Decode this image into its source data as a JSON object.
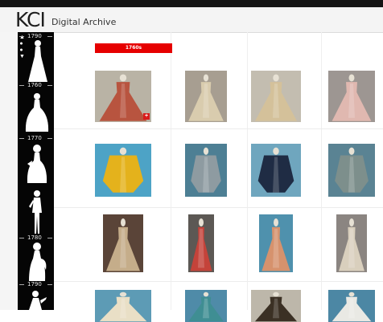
{
  "header": {
    "brand": "KCI",
    "subtitle": "Digital Archive"
  },
  "timeline": {
    "up_icon": "arrow-up-icon",
    "down_icon": "arrow-down-icon",
    "years": [
      "1790",
      "1760",
      "1770",
      "1780",
      "1790"
    ],
    "silhouettes": [
      "gown-icon",
      "gown-icon",
      "gown-icon",
      "figure-icon",
      "gown-icon",
      "figure-icon"
    ]
  },
  "grid": {
    "decade_label": "1760s",
    "rows": [
      [
        {
          "name": "robe-a-la-francaise-floral-red",
          "bg": "#b9b3a5",
          "dress": "#b8543f"
        },
        {
          "name": "robe-a-la-francaise-ivory",
          "bg": "#a79e91",
          "dress": "#d9ccae"
        },
        {
          "name": "robe-a-la-francaise-cream",
          "bg": "#c3bdb0",
          "dress": "#d4c19a"
        },
        {
          "name": "robe-a-la-francaise-pink",
          "bg": "#9d9692",
          "dress": "#e0b8b0"
        }
      ],
      [
        {
          "name": "jacket-yellow",
          "bg": "#4da3c6",
          "dress": "#e4b21c"
        },
        {
          "name": "jacket-grey-blue",
          "bg": "#4d7f94",
          "dress": "#8e9ba1"
        },
        {
          "name": "petticoat-navy",
          "bg": "#6fa6be",
          "dress": "#1f2c44"
        },
        {
          "name": "robe-grey-green",
          "bg": "#5a8393",
          "dress": "#7d8f8c"
        }
      ],
      [
        {
          "name": "robe-a-la-polonaise-beige",
          "bg": "#5a4438",
          "dress": "#c5ad8a"
        },
        {
          "name": "banyan-coat-red",
          "bg": "#5c5854",
          "dress": "#c4433a"
        },
        {
          "name": "robe-floral-orange",
          "bg": "#4f91ad",
          "dress": "#d6926d"
        },
        {
          "name": "robe-cream-silk",
          "bg": "#8b8581",
          "dress": "#d9cfbd"
        }
      ],
      [
        {
          "name": "bodice-cream",
          "bg": "#5d9bb5",
          "dress": "#e9dfc6"
        },
        {
          "name": "coat-teal",
          "bg": "#4f8ba8",
          "dress": "#3f8e93"
        },
        {
          "name": "coat-dark-patterned",
          "bg": "#bdb7aa",
          "dress": "#3b3024"
        },
        {
          "name": "jacket-blue",
          "bg": "#4c87a4",
          "dress": "#e9e9e4"
        }
      ]
    ],
    "badge_icon": "expand-icon",
    "badge_glyph": "+"
  }
}
